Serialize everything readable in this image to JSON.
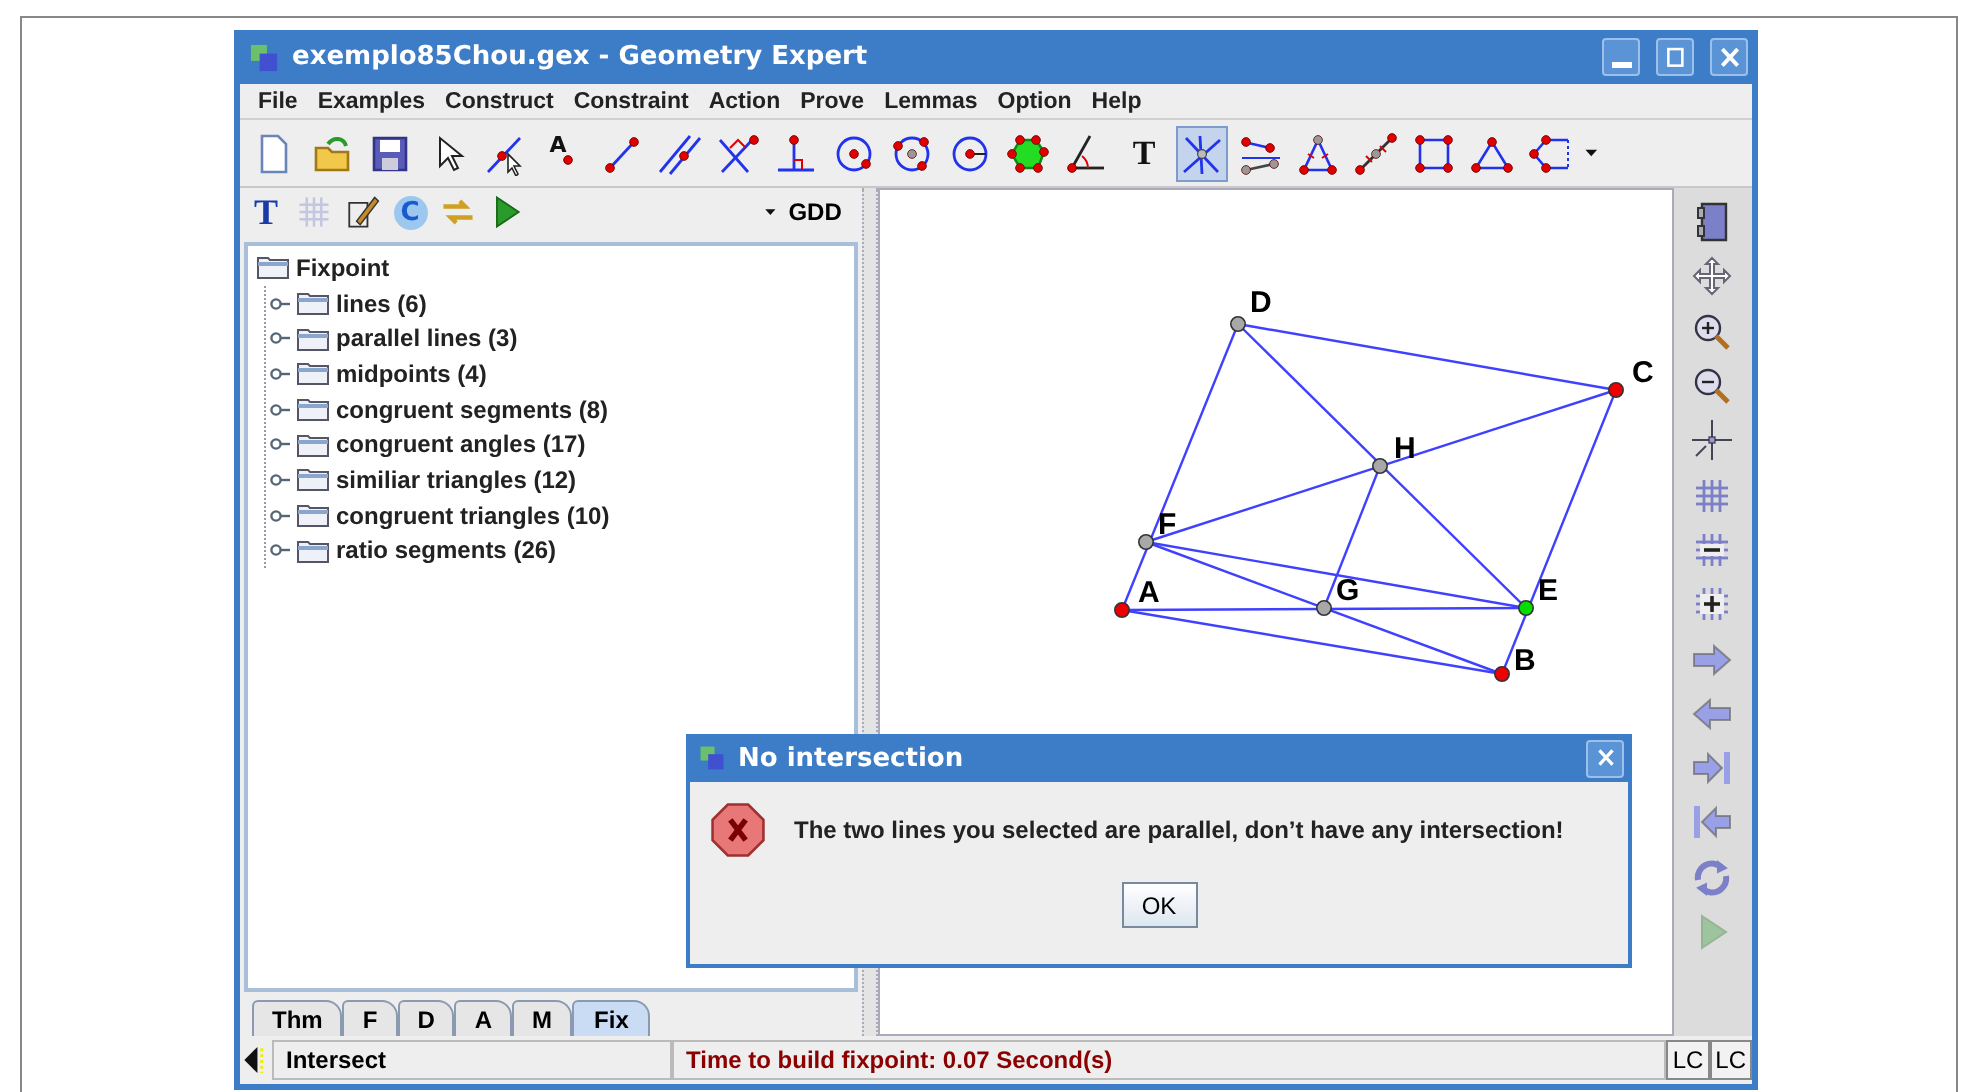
{
  "window": {
    "title": "exemplo85Chou.gex  -  Geometry Expert"
  },
  "menu": [
    "File",
    "Examples",
    "Construct",
    "Constraint",
    "Action",
    "Prove",
    "Lemmas",
    "Option",
    "Help"
  ],
  "toolbar": [
    {
      "kind": "new-file",
      "selected": false
    },
    {
      "kind": "open-folder",
      "selected": false
    },
    {
      "kind": "save",
      "selected": false
    },
    {
      "kind": "pointer",
      "selected": false
    },
    {
      "kind": "point-on-line",
      "selected": false
    },
    {
      "kind": "point-label",
      "glyph": "A",
      "selected": false
    },
    {
      "kind": "segment",
      "selected": false
    },
    {
      "kind": "parallel",
      "selected": false
    },
    {
      "kind": "perpendicular",
      "selected": false
    },
    {
      "kind": "foot",
      "selected": false
    },
    {
      "kind": "circle",
      "selected": false
    },
    {
      "kind": "circle-3pt",
      "selected": false
    },
    {
      "kind": "circle-radius",
      "selected": false
    },
    {
      "kind": "polygon",
      "selected": false
    },
    {
      "kind": "angle",
      "selected": false
    },
    {
      "kind": "text",
      "glyph": "T",
      "selected": false
    },
    {
      "kind": "intersection",
      "selected": true
    },
    {
      "kind": "equal-segments",
      "selected": false
    },
    {
      "kind": "iso-triangle",
      "selected": false
    },
    {
      "kind": "midpoint",
      "selected": false
    },
    {
      "kind": "square",
      "selected": false
    },
    {
      "kind": "triangle",
      "selected": false
    },
    {
      "kind": "pentagon",
      "selected": false
    }
  ],
  "panel": {
    "tools": [
      {
        "kind": "glyph",
        "glyph": "T",
        "disabled": false
      },
      {
        "kind": "grid",
        "disabled": true
      },
      {
        "kind": "pencil",
        "disabled": false
      },
      {
        "kind": "c-circle",
        "glyph": "C",
        "disabled": false
      },
      {
        "kind": "swap",
        "disabled": false
      },
      {
        "kind": "play",
        "disabled": false
      }
    ],
    "mode": "GDD",
    "tree": {
      "label": "Fixpoint",
      "children": [
        {
          "label": "lines (6)",
          "expanded": false
        },
        {
          "label": "parallel lines (3)",
          "expanded": false
        },
        {
          "label": "midpoints (4)",
          "expanded": false
        },
        {
          "label": "congruent segments (8)",
          "expanded": false
        },
        {
          "label": "congruent angles (17)",
          "expanded": false
        },
        {
          "label": "similiar triangles (12)",
          "expanded": false
        },
        {
          "label": "congruent triangles (10)",
          "expanded": false
        },
        {
          "label": "ratio segments (26)",
          "expanded": false
        }
      ]
    },
    "tabs": [
      {
        "label": "Thm",
        "selected": false
      },
      {
        "label": "F",
        "selected": false
      },
      {
        "label": "D",
        "selected": false
      },
      {
        "label": "A",
        "selected": false
      },
      {
        "label": "M",
        "selected": false
      },
      {
        "label": "Fix",
        "selected": true
      }
    ]
  },
  "canvas": {
    "points": [
      {
        "label": "A",
        "color": "#ee0000"
      },
      {
        "label": "B",
        "color": "#ee0000"
      },
      {
        "label": "C",
        "color": "#ee0000"
      },
      {
        "label": "D",
        "color": "#a8a8a8"
      },
      {
        "label": "E",
        "color": "#00e000"
      },
      {
        "label": "F",
        "color": "#a8a8a8"
      },
      {
        "label": "G",
        "color": "#a8a8a8"
      },
      {
        "label": "H",
        "color": "#a8a8a8"
      }
    ]
  },
  "side_tools": [
    {
      "kind": "book",
      "disabled": false
    },
    {
      "kind": "move",
      "disabled": false
    },
    {
      "kind": "zoom-in",
      "disabled": false
    },
    {
      "kind": "zoom-out",
      "disabled": false
    },
    {
      "kind": "crosshair",
      "disabled": false
    },
    {
      "kind": "grid",
      "disabled": false
    },
    {
      "kind": "grid-minus",
      "disabled": false
    },
    {
      "kind": "grid-plus",
      "disabled": false
    },
    {
      "kind": "arrow-right",
      "disabled": false
    },
    {
      "kind": "arrow-left",
      "disabled": false
    },
    {
      "kind": "arrow-right-bar",
      "disabled": false
    },
    {
      "kind": "bar-arrow-left",
      "disabled": false
    },
    {
      "kind": "refresh",
      "disabled": false
    },
    {
      "kind": "play",
      "disabled": true
    }
  ],
  "dialog": {
    "title": "No intersection",
    "message": "The two lines you selected are parallel, don’t have any intersection!",
    "button": "OK"
  },
  "status_bar": {
    "mode": "Intersect",
    "message": "Time to build fixpoint: 0.07 Second(s)",
    "indicators": [
      "LC",
      "LC"
    ]
  }
}
